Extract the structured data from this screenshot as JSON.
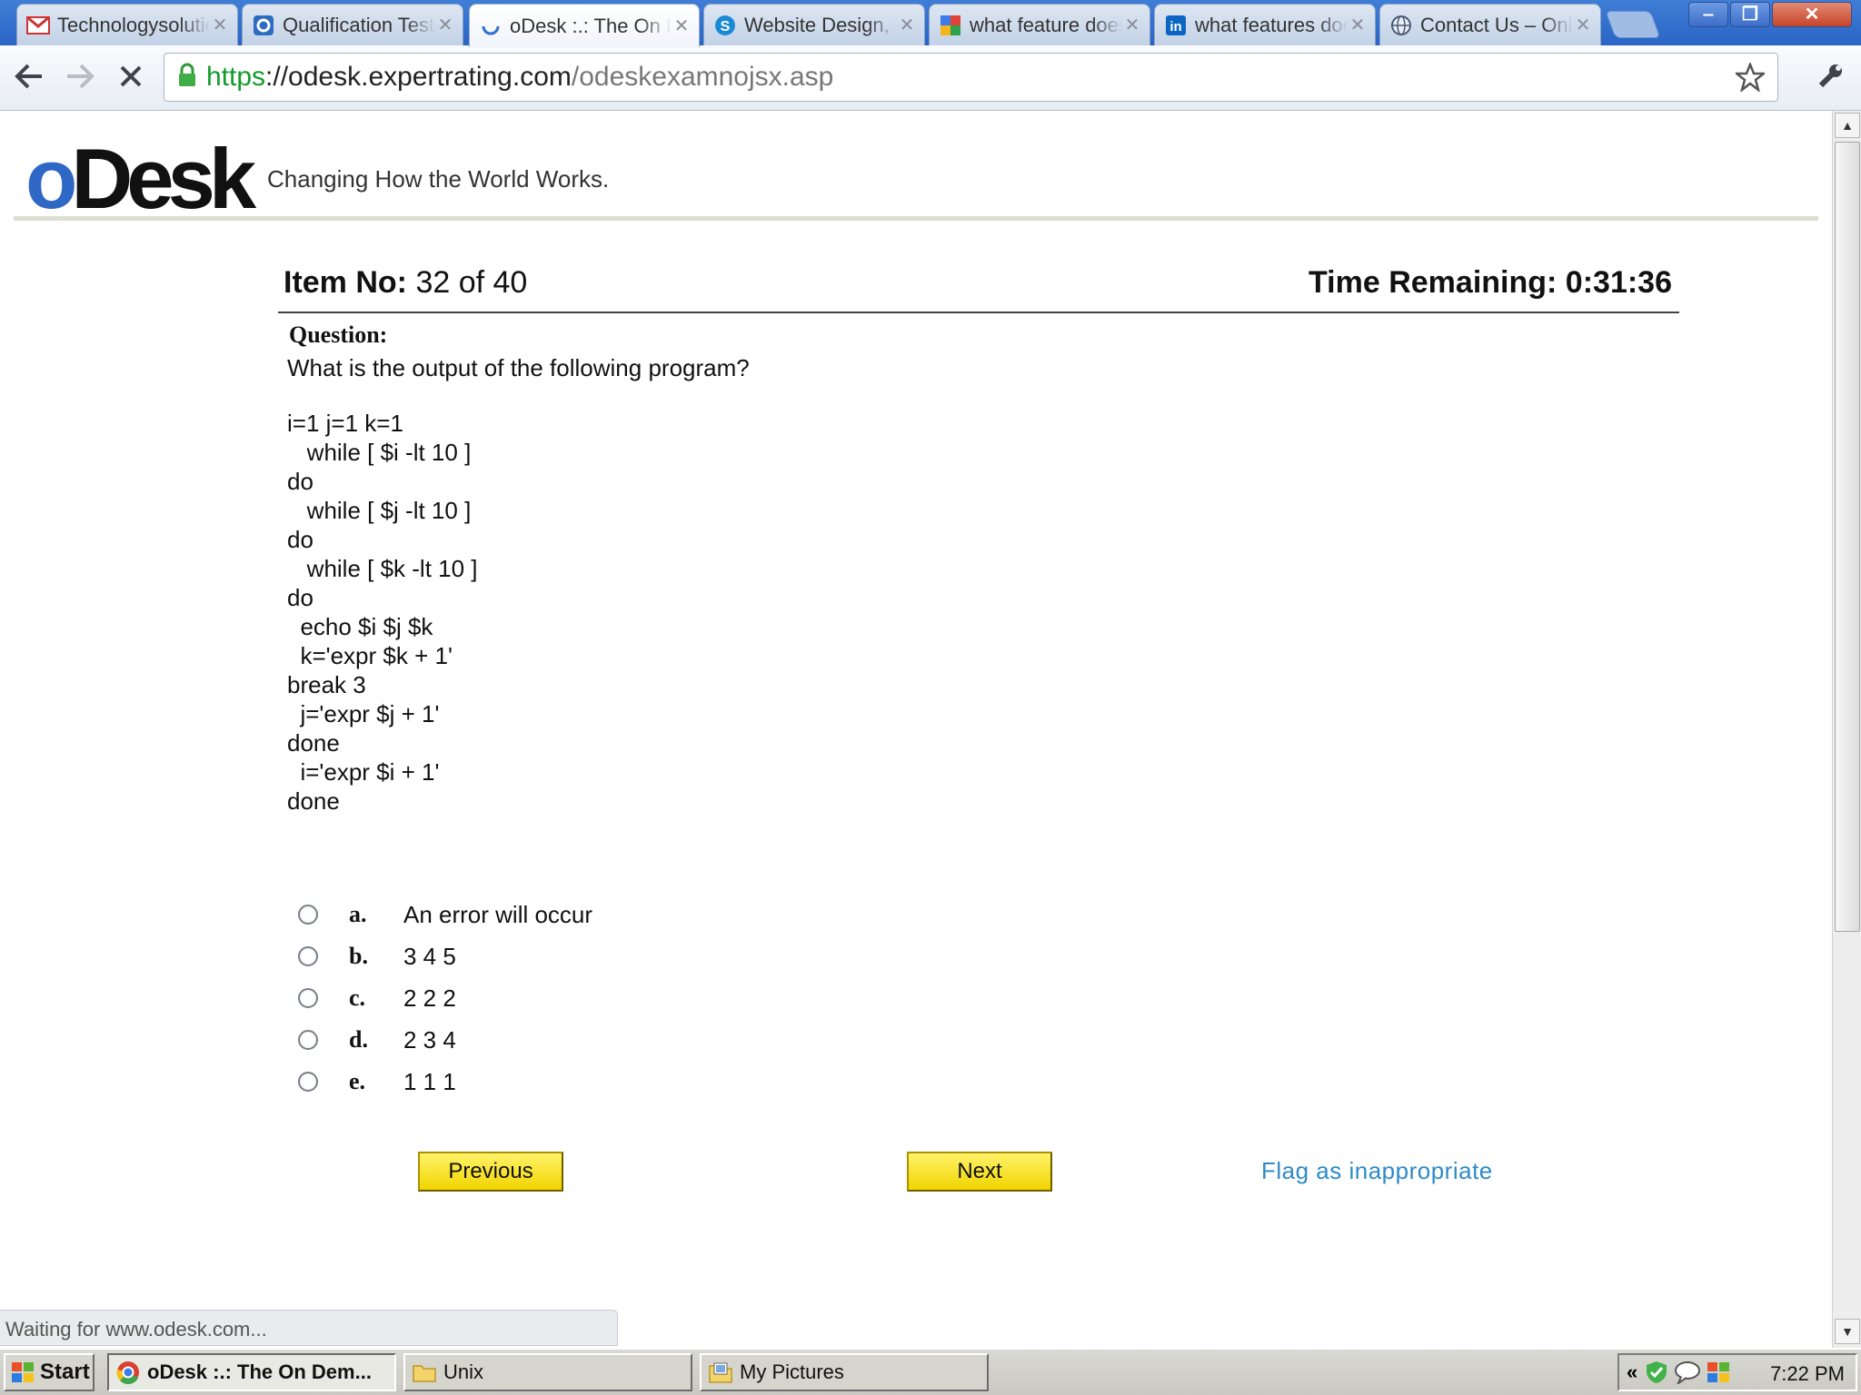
{
  "browser": {
    "tabs": [
      {
        "label": "Technologysolutions",
        "icon": "gmail-icon"
      },
      {
        "label": "Qualification Test",
        "icon": "odesk-tab-icon"
      },
      {
        "label": "oDesk :.: The On Demand",
        "icon": "loading-spinner-icon"
      },
      {
        "label": "Website Design, ",
        "icon": "skype-icon"
      },
      {
        "label": "what feature does",
        "icon": "google-icon"
      },
      {
        "label": "what features does",
        "icon": "linkedin-icon"
      },
      {
        "label": "Contact Us – Online",
        "icon": "globe-icon"
      }
    ],
    "url": {
      "scheme": "https",
      "host": "://odesk.expertrating.com",
      "path": "/odeskexamnojsx.asp"
    }
  },
  "header": {
    "logo_o": "o",
    "logo_rest": "Desk",
    "tagline": "Changing How the World Works."
  },
  "exam": {
    "item_label": "Item No:",
    "item_value": "32 of 40",
    "time_label": "Time Remaining:",
    "time_value": "0:31:36",
    "question_label": "Question:",
    "question_text": "What is the output of the following program?",
    "code_lines": [
      "i=1 j=1 k=1",
      "   while [ $i -lt 10 ]",
      "do",
      "   while [ $j -lt 10 ]",
      "do",
      "   while [ $k -lt 10 ]",
      "do",
      "  echo $i $j $k",
      "  k='expr $k + 1'",
      "break 3",
      "  j='expr $j + 1'",
      "done",
      "  i='expr $i + 1'",
      "done"
    ],
    "options": [
      {
        "letter": "a.",
        "text": "An error will occur"
      },
      {
        "letter": "b.",
        "text": "3 4 5"
      },
      {
        "letter": "c.",
        "text": "2 2 2"
      },
      {
        "letter": "d.",
        "text": "2 3 4"
      },
      {
        "letter": "e.",
        "text": "1 1 1"
      }
    ],
    "previous_label": "Previous",
    "next_label": "Next",
    "flag_label": "Flag as inappropriate"
  },
  "status_text": "Waiting for www.odesk.com...",
  "taskbar": {
    "start_label": "Start",
    "tasks": [
      {
        "label": "oDesk :.: The On Dem...",
        "icon": "chrome-icon"
      },
      {
        "label": "Unix",
        "icon": "folder-icon"
      },
      {
        "label": "My Pictures",
        "icon": "pictures-folder-icon"
      }
    ],
    "clock": "7:22 PM"
  },
  "colors": {
    "accent_link": "#2e8bc8",
    "button_yellow": "#f1d400",
    "logo_blue": "#2f67c5",
    "url_scheme_green": "#139b2a"
  }
}
